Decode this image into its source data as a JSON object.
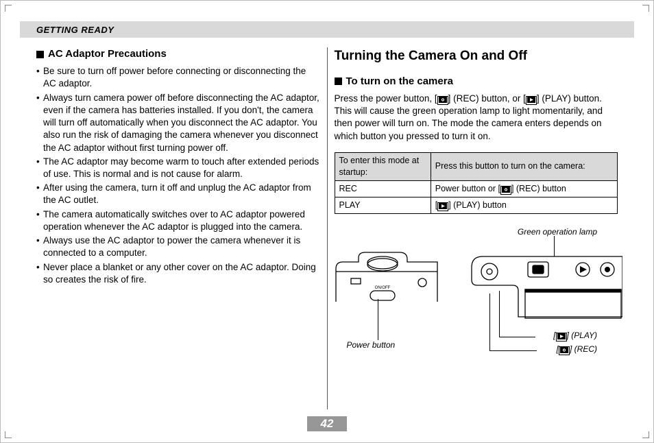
{
  "header": {
    "section": "GETTING READY"
  },
  "left": {
    "subhead": "AC Adaptor Precautions",
    "bullets": [
      "Be sure to turn off power before connecting or disconnecting the AC adaptor.",
      "Always turn camera power off before disconnecting the AC adaptor, even if the camera has batteries installed. If you don't, the camera will turn off automatically when you disconnect the AC adaptor. You also run the risk of damaging the camera whenever you disconnect the AC adaptor without first turning power off.",
      "The AC adaptor may become warm to touch after extended periods of use. This is normal and is not cause for alarm.",
      "After using the camera, turn it off and unplug the AC adaptor from the AC outlet.",
      "The camera automatically switches over to AC adaptor powered operation whenever the AC adaptor is plugged into the camera.",
      "Always use the AC adaptor to power the camera whenever it is connected to a computer.",
      "Never place a blanket or any other cover on the AC adaptor. Doing so creates the risk of fire."
    ]
  },
  "right": {
    "title": "Turning the Camera On and Off",
    "subhead": "To turn on the camera",
    "intro_parts": {
      "a": "Press the power button, [",
      "b": "] (REC) button, or [",
      "c": "] (PLAY) button. This will cause the green operation lamp to light momentarily, and then power will turn on. The mode the camera enters depends on which button you pressed to turn it on."
    },
    "table": {
      "head": {
        "c1": "To enter this mode at startup:",
        "c2": "Press this button to turn on the camera:"
      },
      "rows": [
        {
          "mode": "REC",
          "press_a": "Power button or [",
          "press_b": "] (REC) button"
        },
        {
          "mode": "PLAY",
          "press_a": "[",
          "press_b": "] (PLAY) button"
        }
      ]
    },
    "diagram": {
      "green_lamp": "Green operation lamp",
      "power_btn": "Power button",
      "play_prefix": "[",
      "play_suffix": "] (PLAY)",
      "rec_prefix": "[",
      "rec_suffix": "] (REC)",
      "onoff": "ON/OFF"
    }
  },
  "page_number": "42"
}
